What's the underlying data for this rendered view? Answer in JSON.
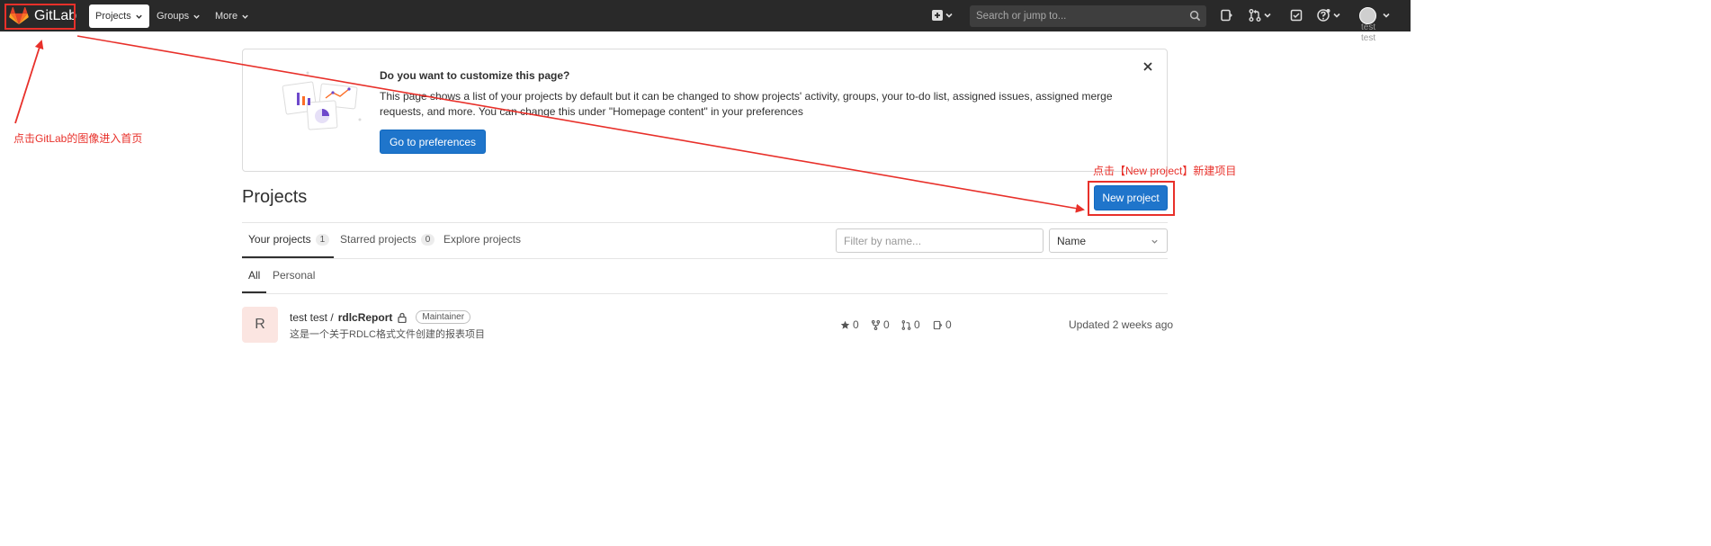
{
  "navbar": {
    "brand": "GitLab",
    "projects_label": "Projects",
    "groups_label": "Groups",
    "more_label": "More",
    "search_placeholder": "Search or jump to...",
    "user_label": "test"
  },
  "annotations": {
    "logo_hint": "点击GitLab的图像进入首页",
    "new_project_hint": "点击【New project】新建项目",
    "color": "#e8302a"
  },
  "callout": {
    "title": "Do you want to customize this page?",
    "body": "This page shows a list of your projects by default but it can be changed to show projects' activity, groups, your to-do list, assigned issues, assigned merge requests, and more. You can change this under \"Homepage content\" in your preferences",
    "button": "Go to preferences"
  },
  "page": {
    "title": "Projects",
    "new_project_button": "New project"
  },
  "tabs": [
    {
      "label": "Your projects",
      "count": "1"
    },
    {
      "label": "Starred projects",
      "count": "0"
    },
    {
      "label": "Explore projects"
    }
  ],
  "subtabs": [
    "All",
    "Personal"
  ],
  "filter": {
    "placeholder": "Filter by name...",
    "sort_value": "Name"
  },
  "project": {
    "avatar_letter": "R",
    "namespace": "test test / ",
    "name": "rdlcReport",
    "role": "Maintainer",
    "description": "这是一个关于RDLC格式文件创建的报表项目",
    "stars": "0",
    "forks": "0",
    "merge_requests": "0",
    "issues": "0",
    "updated": "Updated 2 weeks ago"
  },
  "colors": {
    "navbar_bg": "#292929",
    "primary_button": "#1f75cb",
    "project_avatar_bg": "#fbe5e1"
  },
  "icons": [
    "gitlab-logo-icon",
    "chevron-down-icon",
    "plus-square-icon",
    "search-icon",
    "issues-icon",
    "merge-request-icon",
    "todo-icon",
    "help-icon",
    "close-icon",
    "lock-icon",
    "star-icon",
    "fork-icon"
  ]
}
